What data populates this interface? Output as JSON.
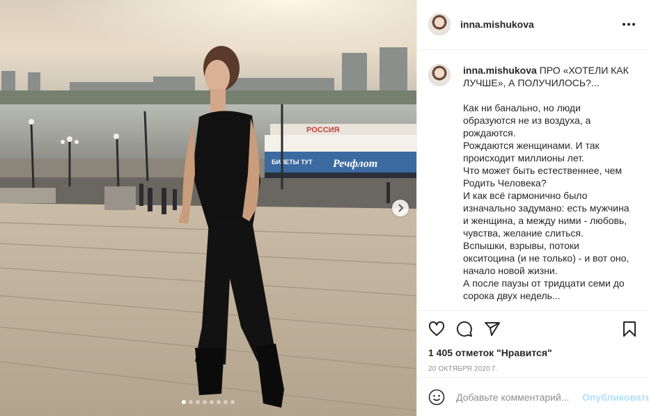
{
  "post": {
    "username": "inna.mishukova",
    "photo": {
      "boat_sign": "БИЛЕТЫ ТУТ",
      "boat_brand": "Речфлот",
      "boat_top_sign": "РОССИЯ",
      "slide_count": 8,
      "active_slide": 1
    },
    "caption": {
      "username": "inna.mishukova",
      "title": "ПРО «ХОТЕЛИ КАК ЛУЧШЕ», А ПОЛУЧИЛОСЬ?...",
      "lines": [
        "Как ни банально, но люди образуются не из воздуха, а рождаются.",
        "Рождаются женщинами. И так происходит миллионы лет.",
        "Что может быть естественнее, чем Родить Человека?",
        "И как всё гармонично было изначально задумано: есть мужчина и женщина, а между ними - любовь, чувства, желание слиться.",
        "Вспышки, взрывы, потоки окситоцина (и не только) - и вот оно, начало новой жизни.",
        "А после паузы от тридцати семи до сорока двух недель..."
      ]
    },
    "likes": "1 405 отметок \"Нравится\"",
    "date": "20 октября 2020 г.",
    "comment": {
      "placeholder": "Добавьте комментарий...",
      "post_label": "Опубликовать"
    },
    "icons": {
      "like": "heart-icon",
      "comment": "comment-icon",
      "share": "share-icon",
      "save": "bookmark-icon",
      "emoji": "emoji-icon",
      "more": "more-icon",
      "next": "chevron-right-icon"
    }
  }
}
